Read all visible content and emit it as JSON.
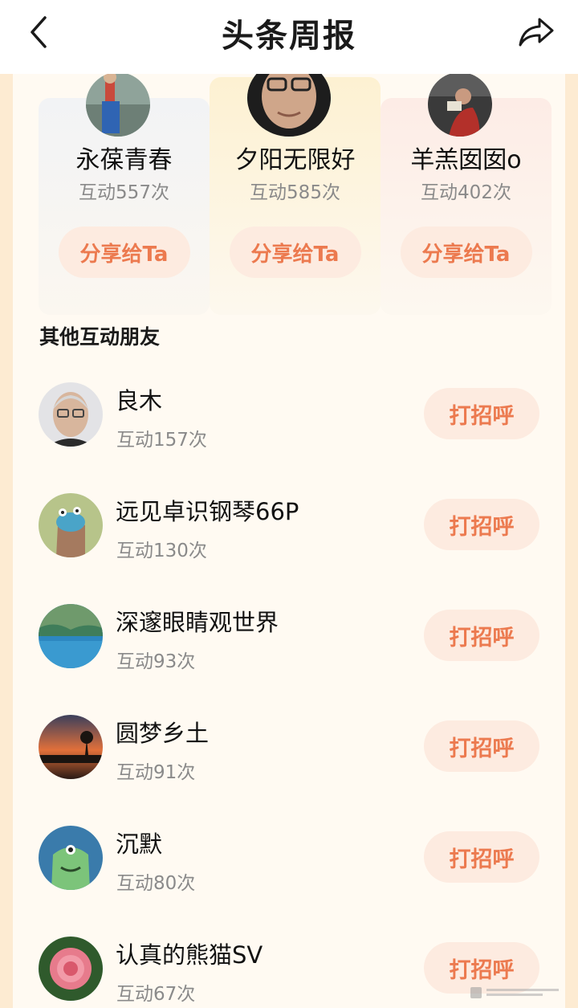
{
  "header": {
    "title": "头条周报"
  },
  "top_friends": [
    {
      "name": "永葆青春",
      "count": "互动557次",
      "button": "分享给Ta"
    },
    {
      "name": "夕阳无限好",
      "count": "互动585次",
      "button": "分享给Ta"
    },
    {
      "name": "羊羔囡囡o",
      "count": "互动402次",
      "button": "分享给Ta"
    }
  ],
  "other": {
    "title": "其他互动朋友",
    "items": [
      {
        "name": "良木",
        "count": "互动157次",
        "button": "打招呼"
      },
      {
        "name": "远见卓识钢琴66P",
        "count": "互动130次",
        "button": "打招呼"
      },
      {
        "name": "深邃眼睛观世界",
        "count": "互动93次",
        "button": "打招呼"
      },
      {
        "name": "圆梦乡土",
        "count": "互动91次",
        "button": "打招呼"
      },
      {
        "name": "沉默",
        "count": "互动80次",
        "button": "打招呼"
      },
      {
        "name": "认真的熊猫SV",
        "count": "互动67次",
        "button": "打招呼"
      }
    ]
  },
  "colors": {
    "accent": "#ec7a4f",
    "button_bg": "#fdebe0",
    "page_bg": "#fdebd2",
    "card_bg": "#fffaf2"
  },
  "icons": {
    "back": "chevron-left-icon",
    "share": "share-arrow-icon"
  }
}
